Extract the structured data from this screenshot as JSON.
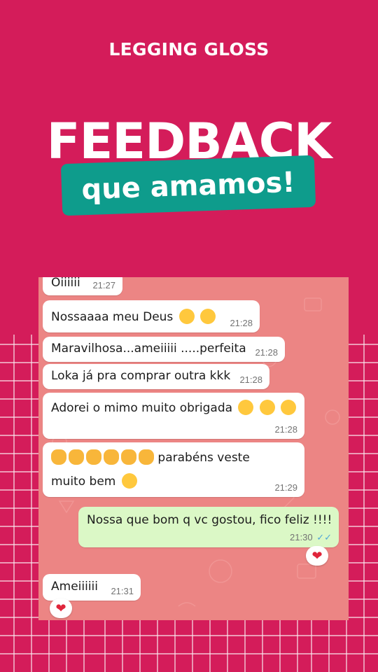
{
  "brand": "LEGGING GLOSS",
  "headline": "FEEDBACK",
  "subtitle": "que amamos!",
  "colors": {
    "background": "#d41c5a",
    "accent": "#0e9c8c",
    "chat_bg": "#ec8584",
    "incoming": "#ffffff",
    "outgoing": "#dbf8c6"
  },
  "chat": {
    "messages": [
      {
        "text": "Oiiiiii",
        "time": "21:27"
      },
      {
        "text": "Nossaaaa meu Deus",
        "time": "21:28",
        "emoji": [
          "face-with-hand-over-mouth-icon",
          "surprised-face-icon"
        ]
      },
      {
        "text": "Maravilhosa...ameiiiii .....perfeita",
        "time": "21:28"
      },
      {
        "text": "Loka já pra comprar outra kkk",
        "time": "21:28"
      },
      {
        "text": "Adorei o mimo muito obrigada",
        "time": "21:28",
        "emoji": [
          "smiling-face-with-hearts-icon",
          "face-blowing-kiss-icon",
          "heart-eyes-icon"
        ]
      },
      {
        "text_line1": "parabéns veste",
        "text_line2": "muito bem",
        "time": "21:29",
        "emoji": [
          "clapping-hands-icon"
        ]
      },
      {
        "text": "Nossa que bom q vc gostou, fico feliz !!!!",
        "time": "21:30",
        "status": "read-ticks-icon",
        "reaction": "heart-icon"
      },
      {
        "text": "Ameiiiiii",
        "time": "21:31",
        "reaction": "heart-icon"
      }
    ]
  }
}
